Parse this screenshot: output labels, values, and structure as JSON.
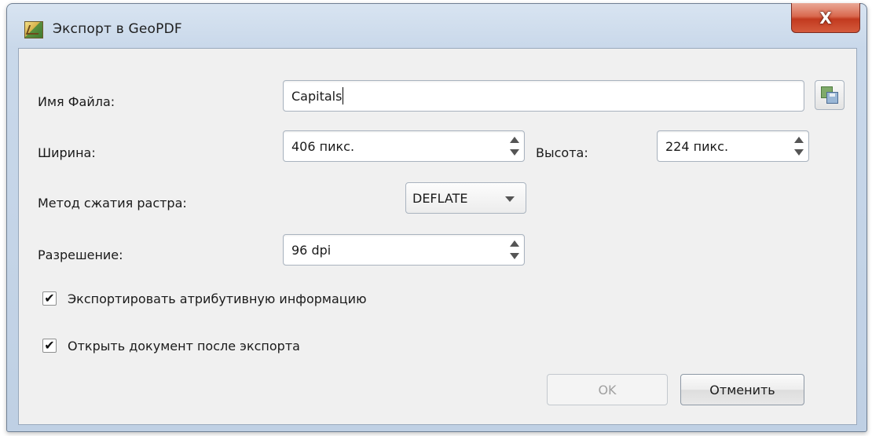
{
  "window": {
    "title": "Экспорт в GeoPDF",
    "close_label": "X"
  },
  "form": {
    "filename": {
      "label": "Имя Файла:",
      "value": "Capitals"
    },
    "width": {
      "label": "Ширина:",
      "value": "406 пикс."
    },
    "height": {
      "label": "Высота:",
      "value": "224 пикс."
    },
    "compression": {
      "label": "Метод сжатия растра:",
      "value": "DEFLATE"
    },
    "resolution": {
      "label": "Разрешение:",
      "value": "96 dpi"
    },
    "export_attributes": {
      "label": "Экспортировать атрибутивную информацию",
      "checked": true,
      "mark": "✔"
    },
    "open_after": {
      "label": "Открыть документ после экспорта",
      "checked": true,
      "mark": "✔"
    }
  },
  "buttons": {
    "ok": {
      "label": "OK",
      "enabled": false
    },
    "cancel": {
      "label": "Отменить",
      "enabled": true
    }
  },
  "icons": {
    "app": "geopdf-app-icon",
    "browse": "save-as-icon",
    "close": "close-icon"
  }
}
